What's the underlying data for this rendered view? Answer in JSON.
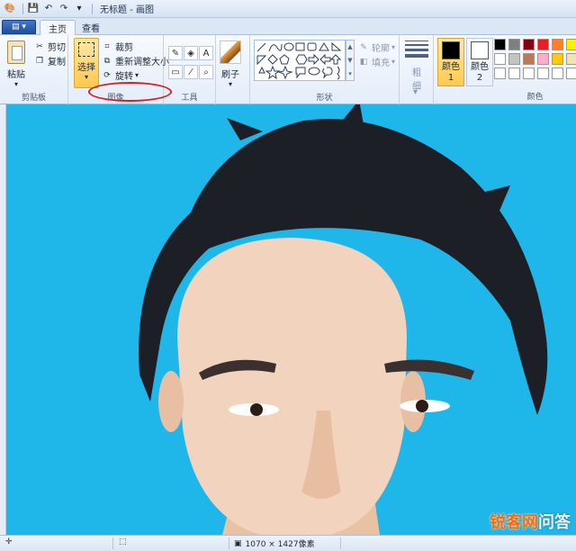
{
  "window": {
    "title": "无标题 - 画图"
  },
  "tabs": {
    "file_label": "▤ ▾",
    "home": "主页",
    "view": "查看"
  },
  "ribbon": {
    "clipboard": {
      "paste": "粘贴",
      "cut": "剪切",
      "copy": "复制",
      "group": "剪贴板"
    },
    "image": {
      "select": "选择",
      "crop": "裁剪",
      "resize": "重新调整大小",
      "rotate": "旋转",
      "group": "图像"
    },
    "tools": {
      "group": "工具",
      "text_glyph": "A"
    },
    "brushes": {
      "label": "刷子"
    },
    "shapes": {
      "outline": "轮廓",
      "fill": "填充",
      "group": "形状"
    },
    "size": {
      "label": "粗细"
    },
    "colors": {
      "color1": "颜色 1",
      "color2": "颜色 2",
      "group": "颜色"
    }
  },
  "palette": [
    "#000000",
    "#7f7f7f",
    "#880015",
    "#ed1c24",
    "#ff7f27",
    "#fff200",
    "#ffffff",
    "#c3c3c3",
    "#b97a57",
    "#ffaec9",
    "#ffc90e",
    "#efe4b0",
    "#ffffff",
    "#ffffff",
    "#ffffff",
    "#ffffff",
    "#ffffff",
    "#ffffff"
  ],
  "canvas": {
    "background": "#1fb6ea"
  },
  "watermark": {
    "brand": "锐客网",
    "rest": "问答"
  },
  "status": {
    "dimensions": "1070 × 1427像素"
  }
}
